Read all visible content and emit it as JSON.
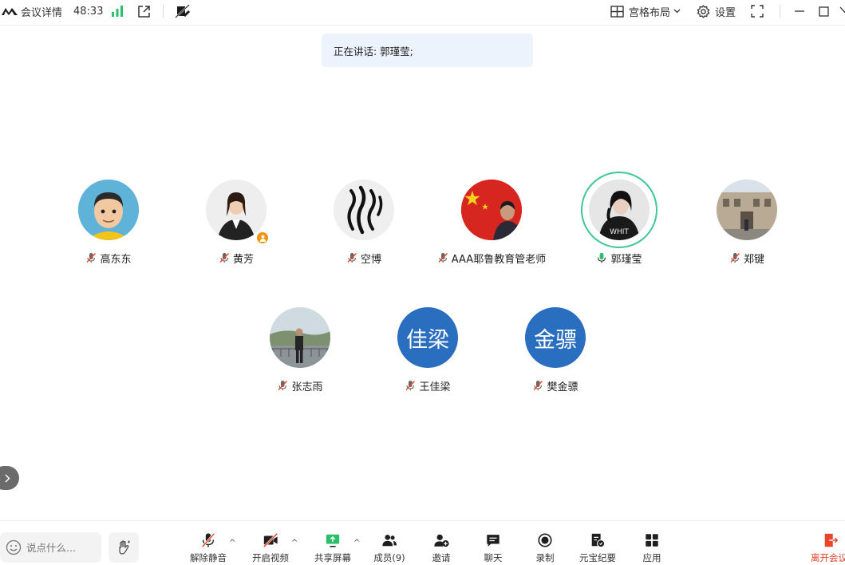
{
  "topbar": {
    "meeting_details": "会议详情",
    "timer": "48:33",
    "layout_label": "宫格布局",
    "settings_label": "设置"
  },
  "speaking": {
    "text": "正在讲话: 郭瑾莹;"
  },
  "participants": [
    {
      "name": "高东东",
      "mic": "muted"
    },
    {
      "name": "黄芳",
      "mic": "muted",
      "host": true
    },
    {
      "name": "空博",
      "mic": "muted"
    },
    {
      "name": "AAA耶鲁教育管老师",
      "mic": "muted"
    },
    {
      "name": "郭瑾莹",
      "mic": "speaking"
    },
    {
      "name": "郑键",
      "mic": "muted"
    },
    {
      "name": "张志雨",
      "mic": "muted"
    },
    {
      "name": "王佳梁",
      "mic": "muted",
      "avatar_text": "佳梁"
    },
    {
      "name": "樊金骠",
      "mic": "muted",
      "avatar_text": "金骠"
    }
  ],
  "chat": {
    "placeholder": "说点什么..."
  },
  "toolbar": {
    "unmute": "解除静音",
    "start_video": "开启视频",
    "share_screen": "共享屏幕",
    "members": "成员(9)",
    "invite": "邀请",
    "chat": "聊天",
    "record": "录制",
    "minutes": "元宝纪要",
    "apps": "应用",
    "leave": "离开会议"
  },
  "colors": {
    "accent_green": "#3fc79a",
    "signal_green": "#2bbf6a",
    "leave_red": "#e8452c",
    "text_avatar_blue": "#2a6ebf",
    "host_badge": "#f2930b"
  }
}
